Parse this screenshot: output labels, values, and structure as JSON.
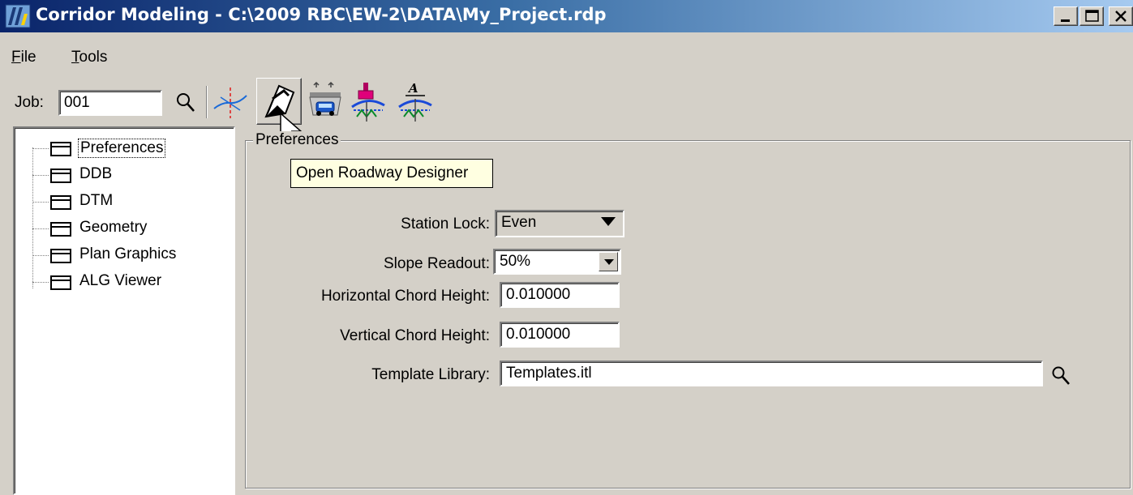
{
  "window": {
    "title": "Corridor Modeling - C:\\2009 RBC\\EW-2\\DATA\\My_Project.rdp"
  },
  "menu": {
    "file_u": "F",
    "file_rest": "ile",
    "tools_u": "T",
    "tools_rest": "ools"
  },
  "toolbar": {
    "job_label": "Job:",
    "job_value": "001",
    "icons": [
      "search-icon",
      "alignment-axis-icon",
      "roadway-designer-icon",
      "corridor-vehicle-icon",
      "template-station-icon",
      "template-annotation-icon"
    ]
  },
  "tree": {
    "items": [
      {
        "label": "Preferences",
        "selected": true
      },
      {
        "label": "DDB"
      },
      {
        "label": "DTM"
      },
      {
        "label": "Geometry"
      },
      {
        "label": "Plan Graphics"
      },
      {
        "label": "ALG Viewer"
      }
    ]
  },
  "preferences": {
    "group_title": "Preferences",
    "tooltip": "Open Roadway Designer",
    "station_lock_label": "Station Lock:",
    "station_lock_value": "Even",
    "slope_readout_label": "Slope Readout:",
    "slope_readout_value": "50%",
    "horizontal_chord_label": "Horizontal Chord Height:",
    "horizontal_chord_value": "0.010000",
    "vertical_chord_label": "Vertical Chord Height:",
    "vertical_chord_value": "0.010000",
    "template_library_label": "Template Library:",
    "template_library_value": "Templates.itl"
  }
}
